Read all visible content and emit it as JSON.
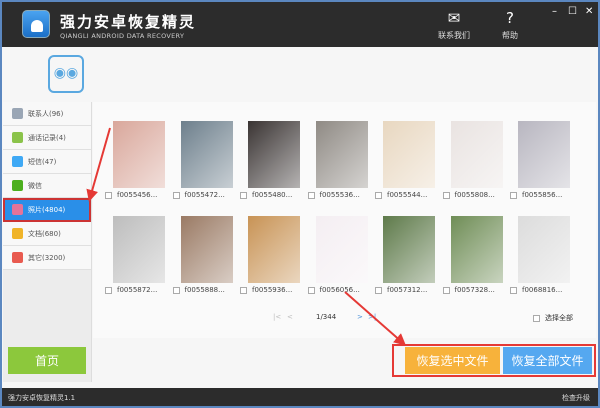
{
  "app": {
    "title": "强力安卓恢复精灵",
    "subtitle": "QIANGLI ANDROID DATA RECOVERY"
  },
  "header": {
    "contact_label": "联系我们",
    "help_label": "帮助",
    "minimize": "–",
    "maximize": "☐",
    "close": "✕"
  },
  "sidebar": {
    "items": [
      {
        "label": "联系人(96)",
        "color": "#9aa6b5"
      },
      {
        "label": "通话记录(4)",
        "color": "#8bc34a"
      },
      {
        "label": "短信(47)",
        "color": "#3fa9f5"
      },
      {
        "label": "微信",
        "color": "#4caf1e"
      },
      {
        "label": "照片(4804)",
        "color": "#e57399"
      },
      {
        "label": "文档(680)",
        "color": "#f0b429"
      },
      {
        "label": "其它(3200)",
        "color": "#e85a4f"
      }
    ]
  },
  "files": [
    {
      "name": "f0055456...",
      "color": "#d9a79b"
    },
    {
      "name": "f0055472...",
      "color": "#6d7f8c"
    },
    {
      "name": "f0055480...",
      "color": "#3a3433"
    },
    {
      "name": "f0055536...",
      "color": "#8f8a84"
    },
    {
      "name": "f0055544...",
      "color": "#e8d7c0"
    },
    {
      "name": "f0055808...",
      "color": "#e9e3e1"
    },
    {
      "name": "f0055856...",
      "color": "#b8b6c0"
    },
    {
      "name": "f0055872...",
      "color": "#bdbdbd"
    },
    {
      "name": "f0055888...",
      "color": "#9a7a64"
    },
    {
      "name": "f0055936...",
      "color": "#c89355"
    },
    {
      "name": "f0056056...",
      "color": "#f4eef2"
    },
    {
      "name": "f0057312...",
      "color": "#5e7a4a"
    },
    {
      "name": "f0057328...",
      "color": "#6f8d56"
    },
    {
      "name": "f0068816...",
      "color": "#dcdcdc"
    }
  ],
  "pager": {
    "first": "|<",
    "prev": "<",
    "page": "1/344",
    "next": ">",
    "last": ">|"
  },
  "select_all_label": "选择全部",
  "buttons": {
    "home": "首页",
    "recover_selected": "恢复选中文件",
    "recover_all": "恢复全部文件"
  },
  "status": {
    "version": "强力安卓恢复精灵1.1",
    "check_update": "检查升级"
  }
}
